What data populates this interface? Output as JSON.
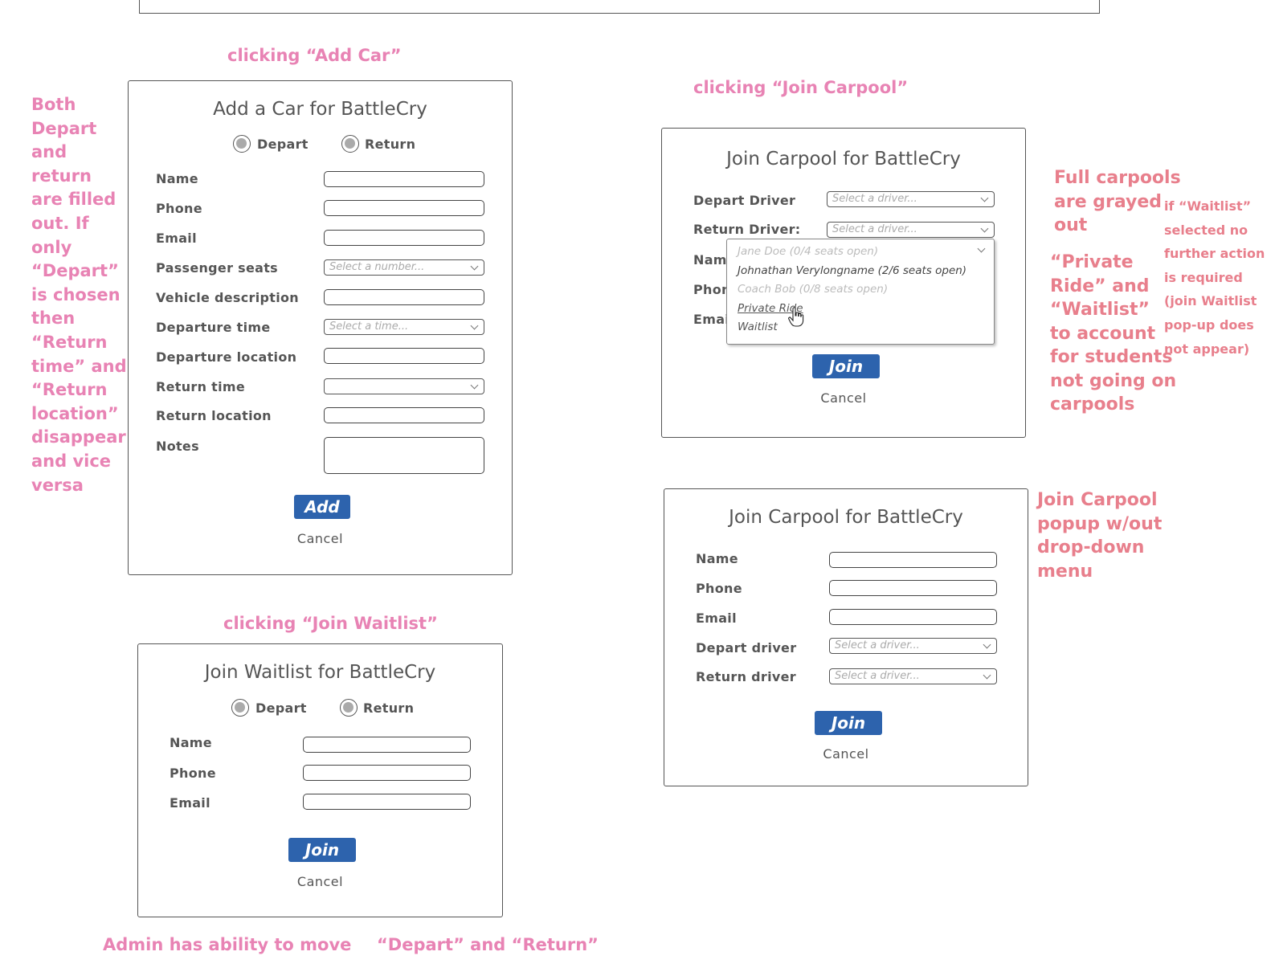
{
  "captions": {
    "add_car": "clicking “Add Car”",
    "join_carpool": "clicking “Join Carpool”",
    "join_waitlist": "clicking “Join Waitlist”"
  },
  "notes": {
    "left": [
      "Both",
      "Depart",
      "and",
      "return",
      "are filled",
      "out. If",
      "only",
      "“Depart”",
      "is chosen",
      "then",
      "“Return",
      "time” and",
      "“Return",
      "location”",
      "disappear",
      "and vice",
      "versa"
    ],
    "full_carpools": [
      "Full carpools",
      "are grayed",
      "out"
    ],
    "private_ride": [
      "“Private",
      "Ride” and",
      "“Waitlist”",
      "to account",
      "for students",
      "not going on",
      "carpools"
    ],
    "waitlist_selected": [
      "if “Waitlist”",
      "selected no",
      "further action",
      "is required",
      "(join Waitlist",
      "pop-up does",
      "not appear)"
    ],
    "popup_without": [
      "Join Carpool",
      "popup w/out",
      "drop-down",
      "menu"
    ],
    "bottom_admin": "Admin has ability to move",
    "bottom_depart_return": "“Depart” and “Return”"
  },
  "add_car": {
    "title": "Add a Car for BattleCry",
    "radio_depart": "Depart",
    "radio_return": "Return",
    "labels": {
      "name": "Name",
      "phone": "Phone",
      "email": "Email",
      "passenger_seats": "Passenger seats",
      "vehicle_description": "Vehicle description",
      "departure_time": "Departure time",
      "departure_location": "Departure location",
      "return_time": "Return time",
      "return_location": "Return location",
      "notes": "Notes"
    },
    "seats_placeholder": "Select a number...",
    "time_placeholder": "Select a time...",
    "add_button": "Add",
    "cancel": "Cancel"
  },
  "join_carpool_dropdown": {
    "title": "Join Carpool for BattleCry",
    "depart_driver_label": "Depart Driver",
    "return_driver_label": "Return Driver:",
    "name_label": "Name",
    "phone_label": "Phone",
    "email_label": "Email",
    "driver_placeholder": "Select a driver...",
    "options": [
      {
        "label": "Jane Doe (0/4 seats open)",
        "state": "disabled"
      },
      {
        "label": "Johnathan Verylongname (2/6 seats open)",
        "state": "enabled"
      },
      {
        "label": "Coach Bob (0/8 seats open)",
        "state": "disabled"
      },
      {
        "label": "Private Ride",
        "state": "hovered"
      },
      {
        "label": "Waitlist",
        "state": "enabled"
      }
    ],
    "join_button": "Join",
    "cancel": "Cancel"
  },
  "join_carpool_plain": {
    "title": "Join Carpool for BattleCry",
    "labels": {
      "name": "Name",
      "phone": "Phone",
      "email": "Email",
      "depart_driver": "Depart driver",
      "return_driver": "Return driver"
    },
    "driver_placeholder": "Select a driver...",
    "join_button": "Join",
    "cancel": "Cancel"
  },
  "join_waitlist": {
    "title": "Join Waitlist for BattleCry",
    "radio_depart": "Depart",
    "radio_return": "Return",
    "labels": {
      "name": "Name",
      "phone": "Phone",
      "email": "Email"
    },
    "join_button": "Join",
    "cancel": "Cancel"
  },
  "colors": {
    "button_blue": "#2d63ad",
    "note_pink": "#e883b4",
    "note_red": "#e87f8c"
  }
}
